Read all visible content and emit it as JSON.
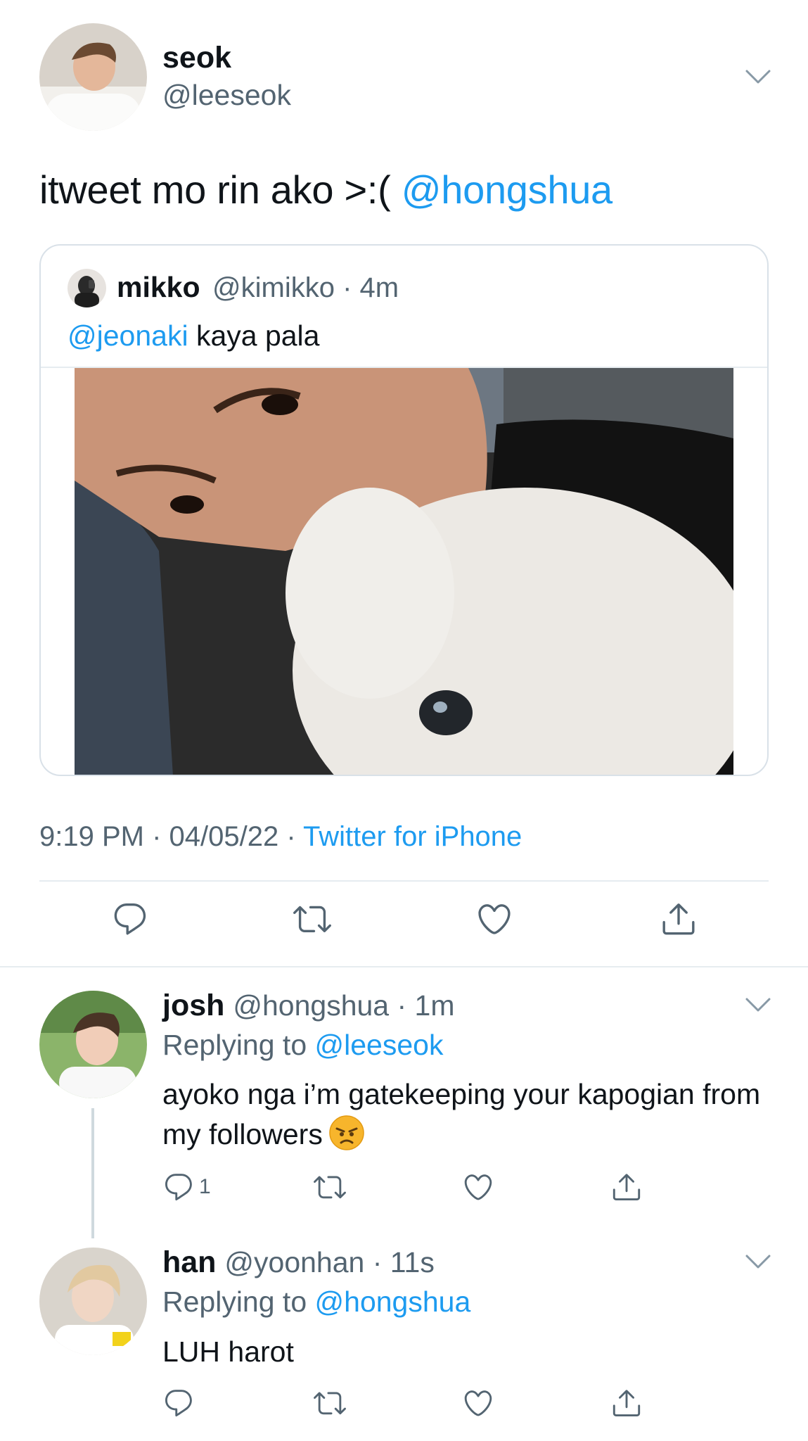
{
  "main_tweet": {
    "author_name": "seok",
    "author_handle": "@leeseok",
    "text_plain": "itweet mo rin ako >:( ",
    "text_mention": "@hongshua",
    "quoted": {
      "author_name": "mikko",
      "author_handle": "@kimikko",
      "time": "4m",
      "mention": "@jeonaki",
      "text": " kaya pala"
    },
    "time": "9:19 PM",
    "date": "04/05/22",
    "source": "Twitter for iPhone"
  },
  "replies": [
    {
      "author_name": "josh",
      "author_handle": "@hongshua",
      "time": "1m",
      "replying_label": "Replying to ",
      "replying_to": "@leeseok",
      "text": "ayoko nga i’m gatekeeping your kapogian from my followers",
      "reply_count": "1"
    },
    {
      "author_name": "han",
      "author_handle": "@yoonhan",
      "time": "11s",
      "replying_label": "Replying to ",
      "replying_to": "@hongshua",
      "text": "LUH harot",
      "reply_count": ""
    }
  ],
  "icons": {
    "reply": "reply-icon",
    "retweet": "retweet-icon",
    "like": "heart-icon",
    "share": "share-icon",
    "more": "chevron-down-icon"
  },
  "colors": {
    "link": "#1d9bf0",
    "muted": "#536471",
    "divider": "#e6ecf0"
  }
}
